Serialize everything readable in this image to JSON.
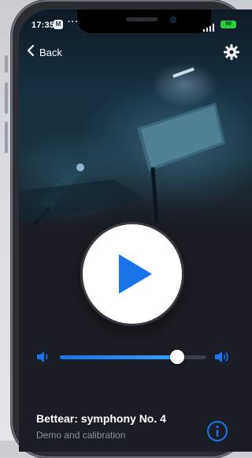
{
  "status": {
    "time": "17:35",
    "badge": "M",
    "dots": "···",
    "battery": "98"
  },
  "nav": {
    "back_label": "Back"
  },
  "player": {
    "title": "Bettear: symphony No. 4",
    "subtitle": "Demo and calibration",
    "volume_level": 0.8
  },
  "colors": {
    "accent": "#1a73e8",
    "background": "#1b1d24"
  },
  "icons": [
    "chevron-left-icon",
    "settings-gear-icon",
    "play-icon",
    "volume-low-icon",
    "volume-high-icon",
    "info-icon"
  ]
}
